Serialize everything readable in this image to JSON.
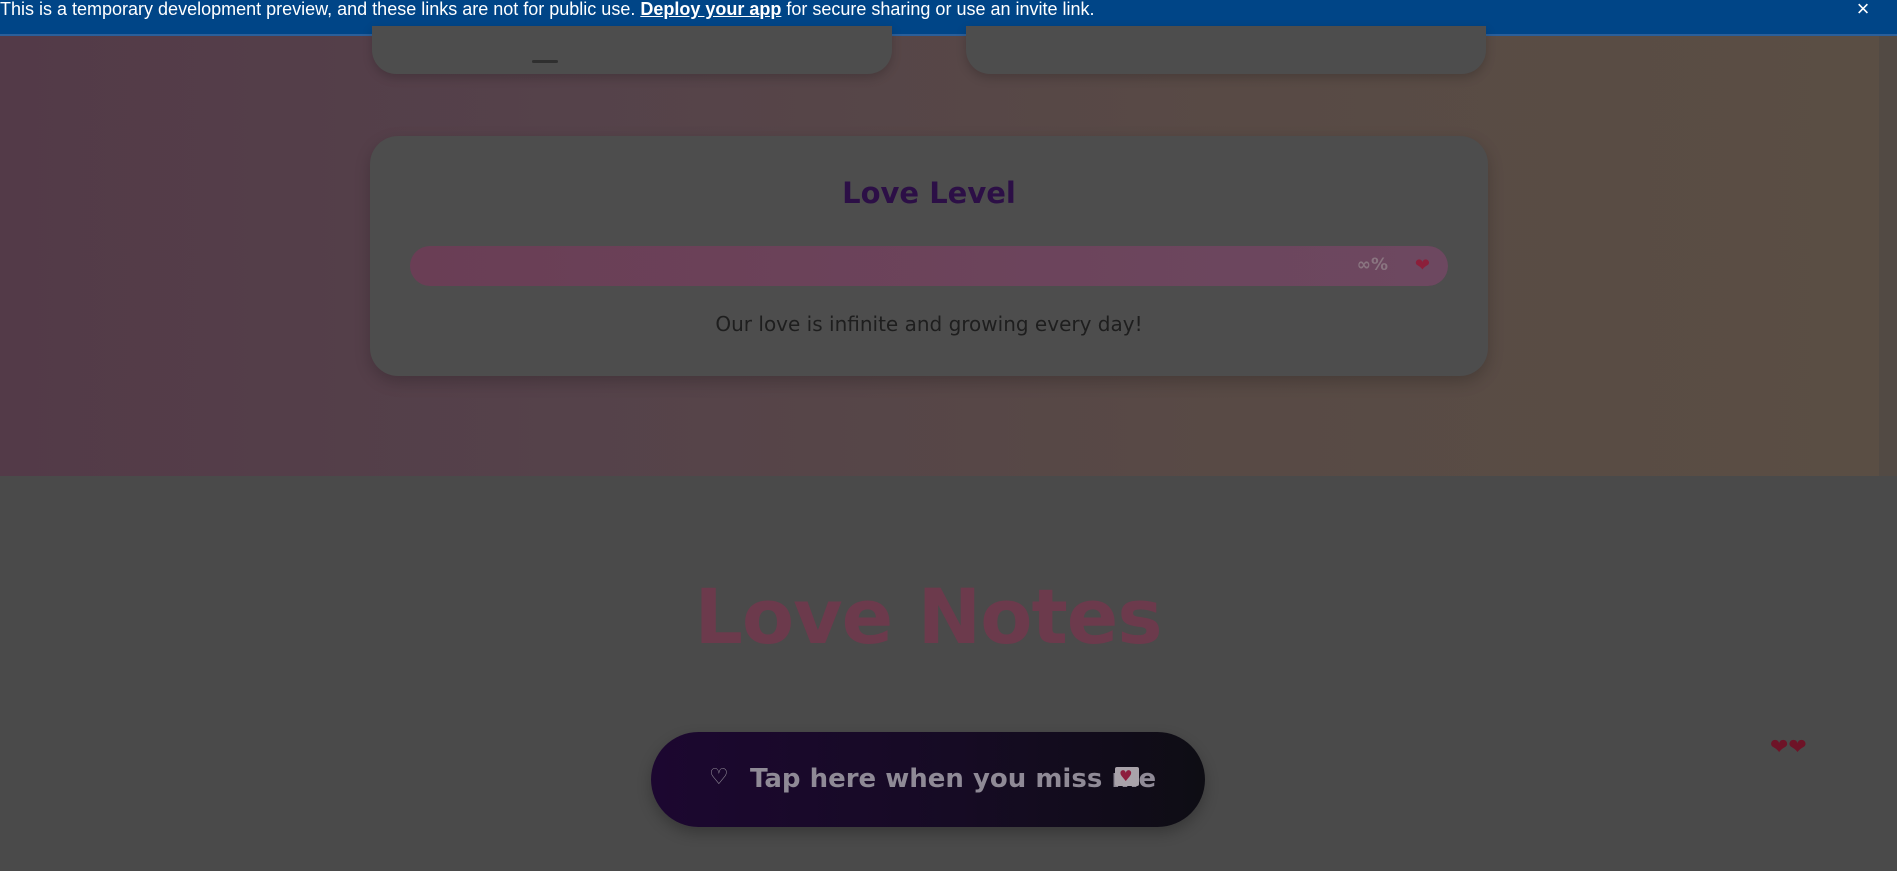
{
  "banner": {
    "text_before": "This is a temporary development preview, and these links are not for public use. ",
    "link_label": "Deploy your app",
    "text_after": " for secure sharing or use an invite link.",
    "close_icon": "×",
    "background": "#004587"
  },
  "love_level": {
    "title": "Love Level",
    "progress_percent": 100,
    "percent_label": "∞%",
    "heart_icon": "❤",
    "subtitle": "Our love is infinite and growing every day!"
  },
  "love_notes": {
    "title": "Love Notes",
    "button_icon": "♡",
    "button_label": "Tap here when you miss me",
    "envelope_icon": "♥"
  },
  "floating_decoration": "❤❤",
  "colors": {
    "accent_pink": "#6c3a4c",
    "title_purple": "#2c0f46",
    "button_gradient_start": "#1c0730",
    "button_gradient_end": "#0e0d14"
  }
}
